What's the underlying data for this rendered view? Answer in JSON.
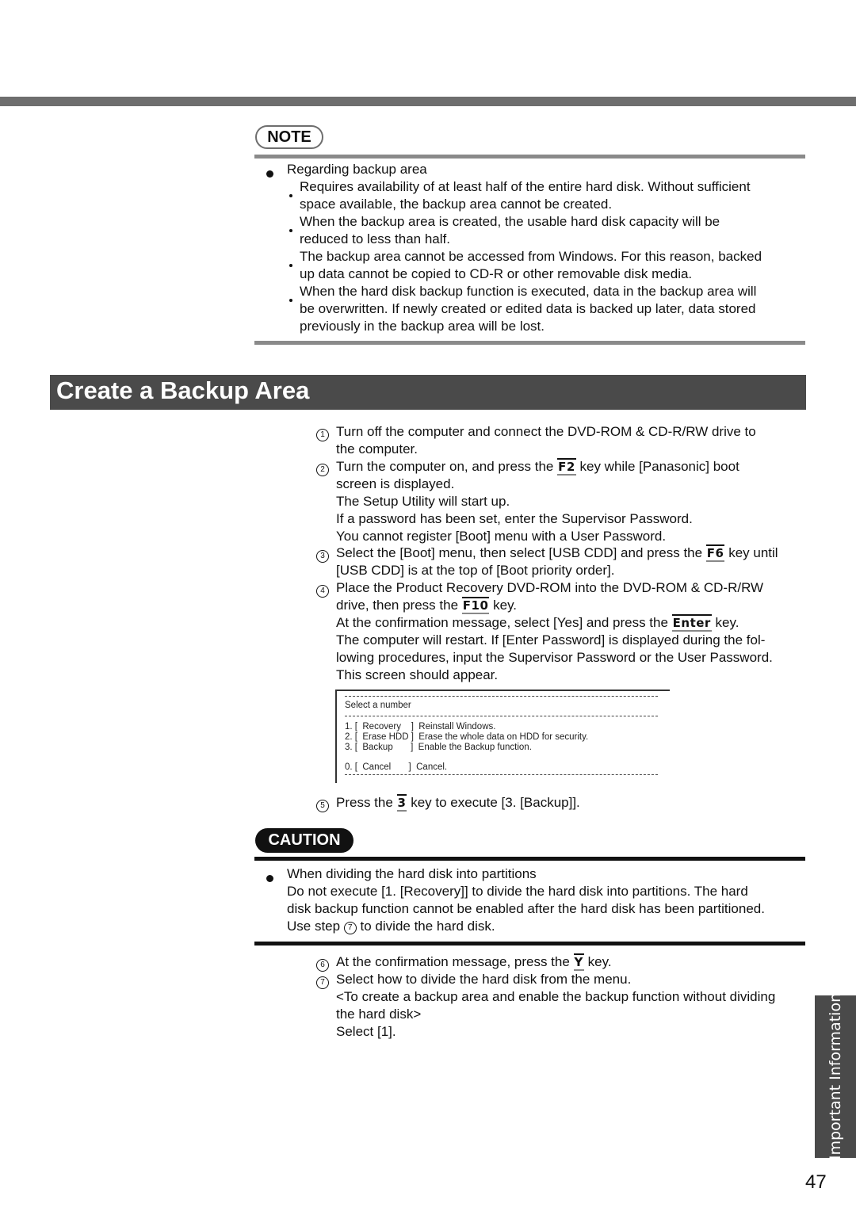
{
  "note": {
    "badge": "NOTE",
    "heading": "Regarding backup area",
    "items": [
      [
        "Requires availability of at least half of the entire hard disk.  Without sufficient",
        "space available, the backup area cannot be created."
      ],
      [
        "When the backup area is created, the usable hard disk capacity will be",
        "reduced to less than half."
      ],
      [
        "The backup area cannot be accessed from Windows.  For this reason, backed",
        "up data cannot be copied to CD-R or other removable disk media."
      ],
      [
        "When the hard disk backup function is executed, data in the backup area will",
        "be overwritten. If newly created or edited data is backed up later, data stored",
        "previously in the backup area will be lost."
      ]
    ]
  },
  "section_title": "Create a Backup Area",
  "steps": {
    "s1": {
      "num": "1",
      "l1": "Turn off the computer and connect the DVD-ROM & CD-R/RW drive to",
      "l2": "the computer."
    },
    "s2": {
      "num": "2",
      "l1a": "Turn the computer on, and press the ",
      "key": "F2",
      "l1b": " key while [Panasonic] boot",
      "l2": "screen is displayed.",
      "l3": "The Setup Utility will start up.",
      "l4": "If a password has been set, enter the Supervisor Password.",
      "l5": "You cannot register [Boot] menu with a User Password."
    },
    "s3": {
      "num": "3",
      "l1a": "Select the [Boot] menu, then select [USB CDD] and press the ",
      "key": "F6",
      "l1b": " key until",
      "l2": "[USB CDD] is at the top of [Boot priority order]."
    },
    "s4": {
      "num": "4",
      "l1": "Place the Product Recovery DVD-ROM into the DVD-ROM & CD-R/RW",
      "l2a": "drive, then press the ",
      "key1": "F10",
      "l2b": " key.",
      "l3a": "At the confirmation message, select [Yes] and press the ",
      "key2": "Enter",
      "l3b": " key.",
      "l4": "The computer will restart. If [Enter Password] is displayed during the fol-",
      "l5": "lowing procedures, input the Supervisor Password or the User Password.",
      "l6": "This screen should appear."
    },
    "s5": {
      "num": "5",
      "a": "Press the ",
      "key": "3",
      "b": " key to execute [3. [Backup]]."
    },
    "s6": {
      "num": "6",
      "a": "At the confirmation message, press the ",
      "key": "Y",
      "b": " key."
    },
    "s7": {
      "num": "7",
      "l1": "Select how to divide the hard disk from the menu.",
      "l2": "<To create a backup area and enable the backup function without dividing",
      "l3": "the hard disk>",
      "l4": "Select [1]."
    }
  },
  "screen": {
    "title": "Select a number",
    "options": [
      "1. [  Recovery    ]  Reinstall Windows.",
      "2. [  Erase HDD ]  Erase the whole data on HDD for security.",
      "3. [  Backup       ]  Enable the Backup function.",
      "0. [  Cancel       ]  Cancel."
    ]
  },
  "caution": {
    "badge": "CAUTION",
    "heading": "When dividing the hard disk into partitions",
    "l1": "Do not execute [1. [Recovery]] to divide the hard disk into partitions.  The hard",
    "l2": "disk backup function cannot be enabled after the hard disk has been partitioned.",
    "l3a": "Use step ",
    "l3num": "7",
    "l3b": " to divide the hard disk."
  },
  "side_tab": "Important Information",
  "page_number": "47"
}
